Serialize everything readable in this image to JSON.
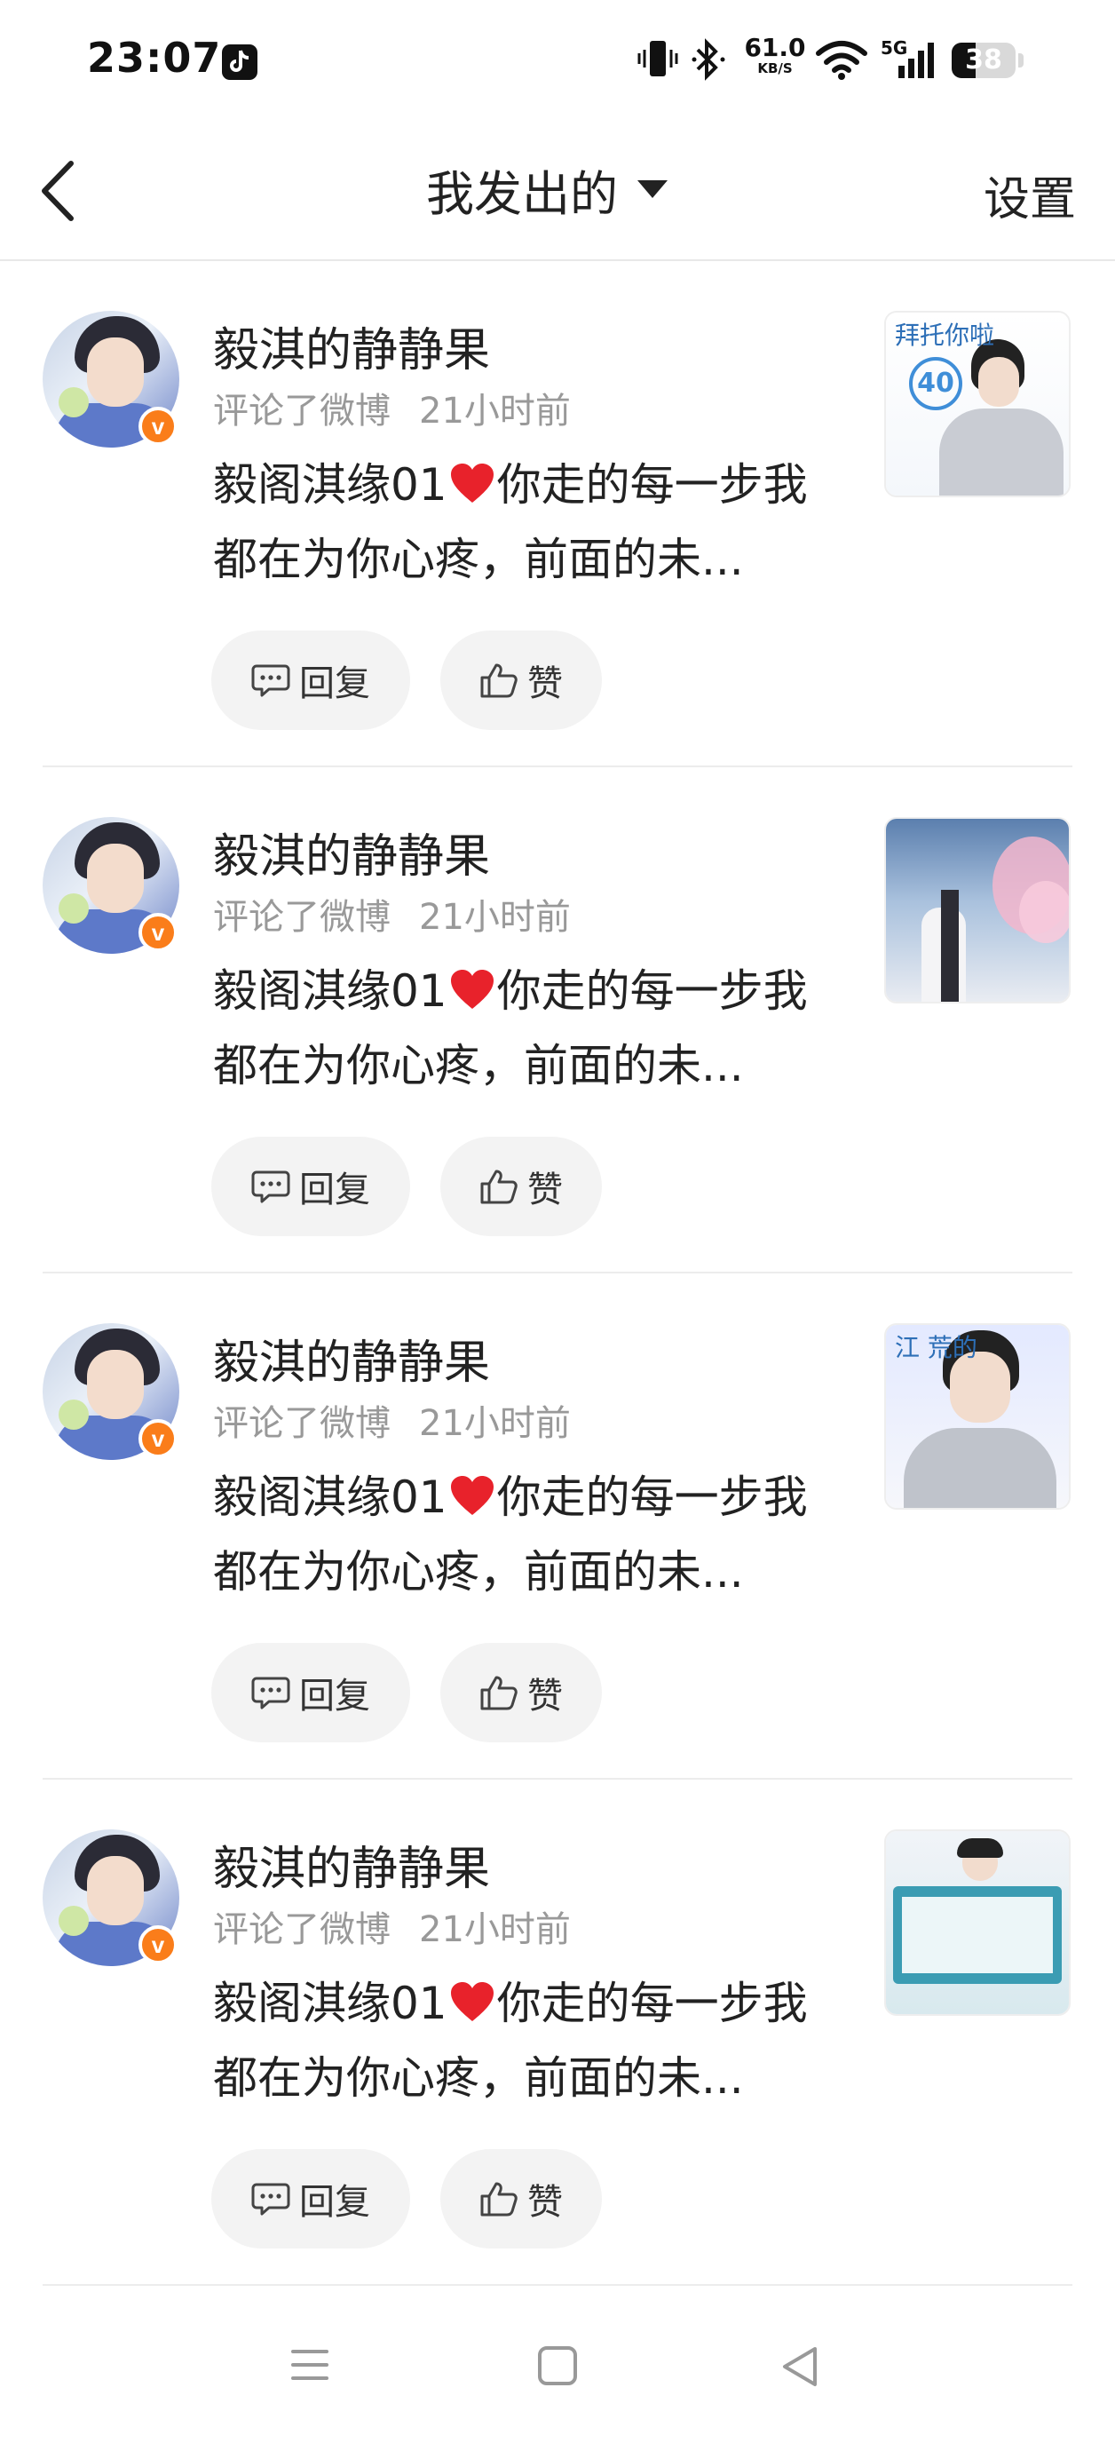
{
  "status_bar": {
    "time": "23:07",
    "net_speed_value": "61.0",
    "net_speed_unit": "KB/S",
    "network_type": "5G",
    "battery_level": "38",
    "battery_fraction": 0.38
  },
  "header": {
    "title": "我发出的",
    "settings_label": "设置"
  },
  "comments": [
    {
      "username": "毅淇的静静果",
      "action": "评论了微博",
      "time": "21小时前",
      "text_before": "毅阁淇缘01",
      "text_after": "你走的每一步我都在为你心疼，前面的未...",
      "reply_label": "回复",
      "like_label": "赞",
      "thumb_label": "拜托你啦",
      "thumb_style": "portrait-40"
    },
    {
      "username": "毅淇的静静果",
      "action": "评论了微博",
      "time": "21小时前",
      "text_before": "毅阁淇缘01",
      "text_after": "你走的每一步我都在为你心疼，前面的未...",
      "reply_label": "回复",
      "like_label": "赞",
      "thumb_label": "",
      "thumb_style": "sky-blossom"
    },
    {
      "username": "毅淇的静静果",
      "action": "评论了微博",
      "time": "21小时前",
      "text_before": "毅阁淇缘01",
      "text_after": "你走的每一步我都在为你心疼，前面的未...",
      "reply_label": "回复",
      "like_label": "赞",
      "thumb_label": "江 荒的",
      "thumb_style": "portrait-stage"
    },
    {
      "username": "毅淇的静静果",
      "action": "评论了微博",
      "time": "21小时前",
      "text_before": "毅阁淇缘01",
      "text_after": "你走的每一步我都在为你心疼，前面的未...",
      "reply_label": "回复",
      "like_label": "赞",
      "thumb_label": "",
      "thumb_style": "board"
    }
  ],
  "colors": {
    "verified_badge": "#fa7d1a",
    "heart": "#e8222b",
    "meta_text": "#999999",
    "button_bg": "#f3f3f3"
  }
}
